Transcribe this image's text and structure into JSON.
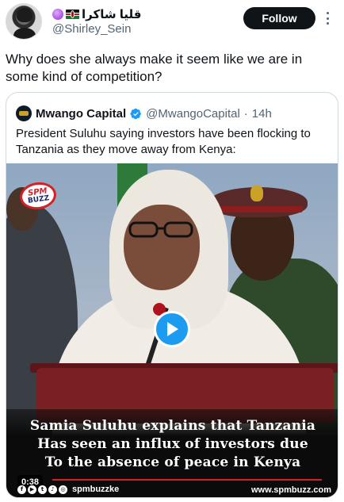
{
  "author": {
    "display_name": "قليا شاكرا",
    "handle": "@Shirley_Sein",
    "avatar_icon": "profile-photo-icon",
    "emoji_icons": [
      "purple-circle-icon",
      "kenya-flag-icon"
    ]
  },
  "actions": {
    "follow_label": "Follow",
    "more_icon": "more-dots-icon"
  },
  "tweet": {
    "text": "Why does she always make it seem like we are in some kind of competition?"
  },
  "quote": {
    "name": "Mwango Capital",
    "handle": "@MwangoCapital",
    "separator": "·",
    "time": "14h",
    "verified_color": "#1d9bf0",
    "text": "President Suluhu saying investors have been flocking to Tanzania as they move away from Kenya:"
  },
  "video": {
    "logo_line1": "SPM",
    "logo_line2": "BUZZ",
    "caption_line1": "Samia Suluhu explains that Tanzania",
    "caption_line2": "Has seen an influx of investors due",
    "caption_line3": "To the absence of peace in Kenya",
    "duration": "0:38",
    "social_handle": "spmbuzzke",
    "website": "www.spmbuzz.com",
    "play_color": "#1d9bf0",
    "social_icons": [
      "facebook-icon",
      "youtube-icon",
      "twitter-icon",
      "tiktok-icon",
      "instagram-icon"
    ]
  }
}
